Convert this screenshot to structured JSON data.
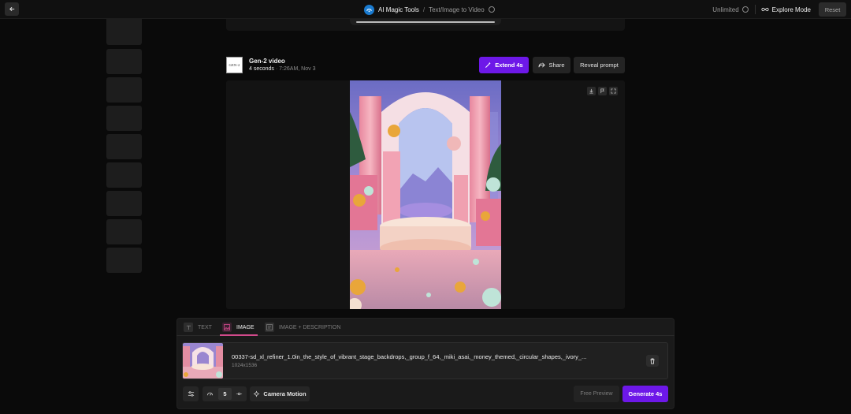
{
  "topbar": {
    "app_name": "AI Magic Tools",
    "separator": "/",
    "page_name": "Text/Image to Video",
    "plan_label": "Unlimited",
    "explore_label": "Explore Mode",
    "reset_label": "Reset"
  },
  "video": {
    "badge_text": "GEN-2",
    "title": "Gen-2 video",
    "duration": "4 seconds",
    "meta_sep": " · ",
    "timestamp": "7:26AM, Nov 3",
    "extend_label": "Extend 4s",
    "share_label": "Share",
    "reveal_label": "Reveal prompt"
  },
  "panel": {
    "tabs": [
      {
        "label": "TEXT",
        "icon": "text-icon",
        "active": false
      },
      {
        "label": "IMAGE",
        "icon": "image-icon",
        "active": true
      },
      {
        "label": "IMAGE + DESCRIPTION",
        "icon": "image-description-icon",
        "active": false
      }
    ],
    "asset": {
      "filename": "00337-sd_xl_refiner_1.0in_the_style_of_vibrant_stage_backdrops,_group_f_64,_miki_asai,_money_themed,_circular_shapes,_ivory_...",
      "dimensions": "1024x1536"
    },
    "speed_value": "5",
    "camera_label": "Camera Motion",
    "free_preview_label": "Free Preview",
    "generate_label": "Generate 4s"
  },
  "colors": {
    "accent": "#6d18e8",
    "tab_underline": "#d14a8b"
  }
}
